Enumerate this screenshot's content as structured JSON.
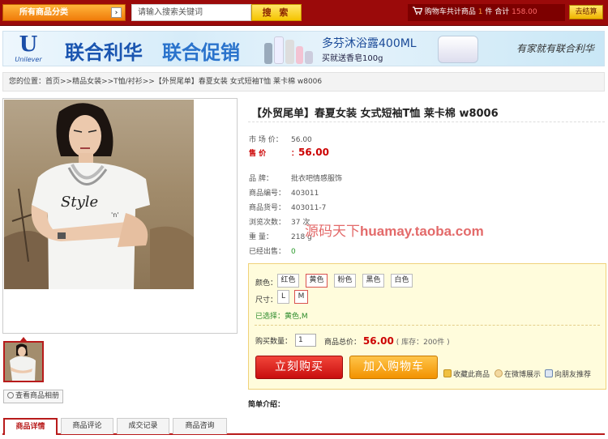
{
  "topbar": {
    "category_label": "所有商品分类",
    "category_arrow": "›",
    "search_placeholder": "请输入搜索关键词",
    "search_button": "搜 索",
    "cart_label": "购物车共计商品",
    "cart_count": "1",
    "cart_unit": "件 合计",
    "cart_total": "158.00",
    "checkout_button": "去结算"
  },
  "banner": {
    "brand_logo_text": "Unilever",
    "headline_1": "联合利华",
    "headline_2": "联合促销",
    "product_line_1": "多芬沐浴露400ML",
    "product_line_2": "买就送香皂100g",
    "slogan": "有家就有联合利华"
  },
  "breadcrumb": "您的位置：首页>>精品女装>>T恤/衬衫>>【外贸尾单】春夏女装 女式短袖T恤 莱卡棉 w8006",
  "gallery": {
    "album_button": "查看商品相册"
  },
  "product": {
    "title": "【外贸尾单】春夏女装 女式短袖T恤 莱卡棉 w8006",
    "market_price_label": "市 场 价：",
    "market_price": "56.00",
    "sale_price_label": "售  价",
    "sale_price_colon": "：",
    "sale_price": "56.00",
    "brand_label": "品  牌：",
    "brand": "批衣吧情感服饰",
    "item_no_label": "商品编号：",
    "item_no": "403011",
    "sku_label": "商品货号：",
    "sku": "403011-7",
    "views_label": "浏览次数：",
    "views": "37 次",
    "weight_label": "重  量：",
    "weight": "218 g",
    "sold_label": "已经出售：",
    "sold": "0"
  },
  "watermark": {
    "cn": "源码天下",
    "en": "huamay.taoba.com"
  },
  "options": {
    "color_label": "颜色：",
    "colors": [
      "红色",
      "黄色",
      "粉色",
      "黑色",
      "白色"
    ],
    "selected_color": "黄色",
    "size_label": "尺寸：",
    "sizes": [
      "L",
      "M"
    ],
    "selected_size": "M",
    "chosen_text": "已选择：黄色,M",
    "qty_label": "购买数量：",
    "qty_value": "1",
    "total_label": "商品总价：",
    "total": "56.00",
    "stock": "( 库存：200件 )",
    "buy_now": "立刻购买",
    "add_to_cart": "加入购物车",
    "favorite": "收藏此商品",
    "weibo": "在微博展示",
    "recommend": "向朋友推荐"
  },
  "brief_label": "简单介绍：",
  "tabs": [
    "商品详情",
    "商品评论",
    "成交记录",
    "商品咨询"
  ],
  "colors": {
    "topbar": "#9b0a0a",
    "accent_red": "#cc0000",
    "buy_button": "#d41a1a",
    "cart_button": "#f5a623"
  }
}
